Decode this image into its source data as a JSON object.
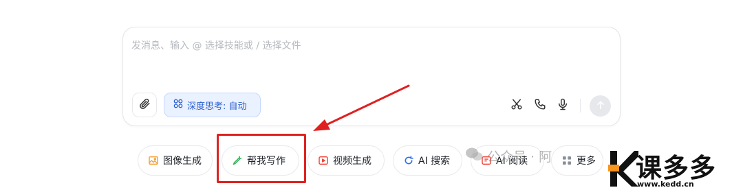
{
  "composer": {
    "placeholder": "发消息、输入 @ 选择技能或 / 选择文件",
    "deep_think_label": "深度思考: 自动"
  },
  "quick_actions": [
    {
      "label": "图像生成",
      "icon": "image-icon",
      "color": "#f2a33a"
    },
    {
      "label": "帮我写作",
      "icon": "pen-icon",
      "color": "#35b35a"
    },
    {
      "label": "视频生成",
      "icon": "video-icon",
      "color": "#f04438"
    },
    {
      "label": "AI 搜索",
      "icon": "search-refresh-icon",
      "color": "#2b6fe6"
    },
    {
      "label": "AI 阅读",
      "icon": "read-icon",
      "color": "#f04438"
    },
    {
      "label": "更多",
      "icon": "grid-icon",
      "color": "#8a8f99"
    }
  ],
  "watermark": {
    "text": "公众号 · 阿"
  },
  "logo": {
    "main": "课多多",
    "url": "www.kedd.cn"
  },
  "colors": {
    "accent_blue": "#2b5ecf",
    "highlight_red": "#e02020"
  }
}
